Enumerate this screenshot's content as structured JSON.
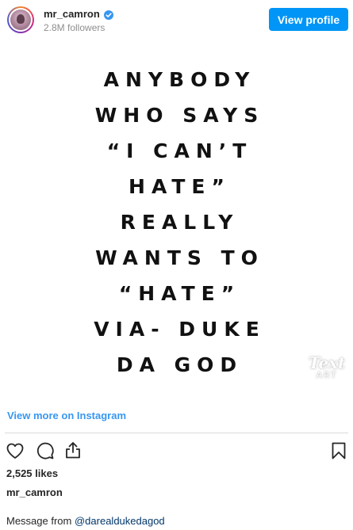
{
  "header": {
    "username": "mr_camron",
    "followers": "2.8M followers",
    "view_profile_label": "View profile",
    "verified_icon": "verified-badge-icon",
    "accent_color": "#0095f6"
  },
  "post": {
    "lines": [
      "ANYBODY",
      "WHO SAYS",
      "“I CAN’T",
      "HATE”",
      "REALLY",
      "WANTS TO",
      "“HATE”",
      "VIA- DUKE",
      "DA GOD"
    ],
    "watermark_main": "Text",
    "watermark_sub": "ART"
  },
  "footer": {
    "view_more_label": "View more on Instagram",
    "link_color": "#3897f0",
    "icons": [
      "heart-icon",
      "comment-icon",
      "share-icon",
      "bookmark-icon"
    ],
    "likes": "2,525 likes",
    "caption_user": "mr_camron",
    "caption_prefix": "Message from ",
    "caption_mention": "@darealdukedagod"
  }
}
